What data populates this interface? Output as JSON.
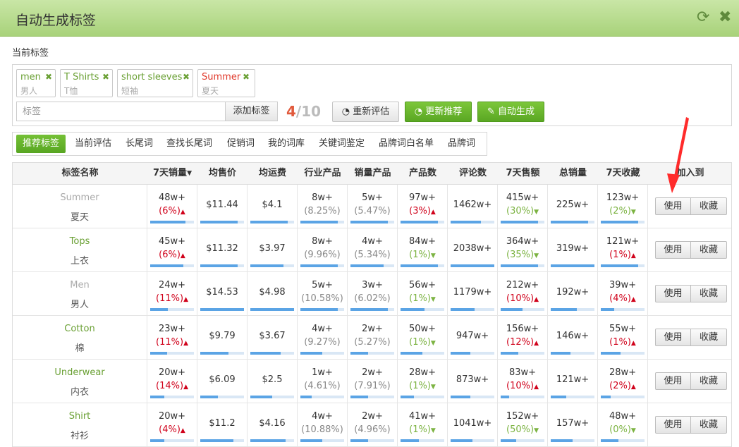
{
  "window": {
    "title": "自动生成标签"
  },
  "current_tags": {
    "label": "当前标签",
    "tags": [
      {
        "en": "men",
        "cn": "男人",
        "color": "green"
      },
      {
        "en": "T Shirts",
        "cn": "T恤",
        "color": "green"
      },
      {
        "en": "short sleeves",
        "cn": "短袖",
        "color": "green"
      },
      {
        "en": "Summer",
        "cn": "夏天",
        "color": "red"
      }
    ],
    "input_placeholder": "标签",
    "add_label": "添加标签",
    "count_current": "4",
    "count_separator": "/",
    "count_max": "10",
    "reevaluate_label": "重新评估",
    "update_recommend_label": "更新推荐",
    "auto_generate_label": "自动生成"
  },
  "tabs": [
    "推荐标签",
    "当前评估",
    "长尾词",
    "查找长尾词",
    "促销词",
    "我的词库",
    "关键词鉴定",
    "品牌词白名单",
    "品牌词"
  ],
  "table": {
    "headers": [
      "标签名称",
      "7天销量",
      "均售价",
      "均运费",
      "行业产品",
      "销量产品",
      "产品数",
      "评论数",
      "7天售额",
      "总销量",
      "7天收藏",
      "加入到"
    ],
    "use_label": "使用",
    "collect_label": "收藏",
    "rows": [
      {
        "en": "Summer",
        "cn": "夏天",
        "en_grey": true,
        "sales7": "48w+",
        "sales7_pct": "(6%)",
        "sales7_dir": "up",
        "price": "$11.44",
        "ship": "$4.1",
        "industry": "8w+",
        "industry_pct": "(8.25%)",
        "salesprod": "5w+",
        "salesprod_pct": "(5.47%)",
        "prodcount": "97w+",
        "prodcount_pct": "(3%)",
        "prodcount_dir": "up",
        "reviews": "1462w+",
        "rev7": "415w+",
        "rev7_pct": "(30%)",
        "rev7_dir": "down",
        "total": "225w+",
        "fav7": "123w+",
        "fav7_pct": "(2%)",
        "fav7_dir": "down"
      },
      {
        "en": "Tops",
        "cn": "上衣",
        "en_grey": false,
        "sales7": "45w+",
        "sales7_pct": "(6%)",
        "sales7_dir": "up",
        "price": "$11.32",
        "ship": "$3.97",
        "industry": "8w+",
        "industry_pct": "(9.96%)",
        "salesprod": "4w+",
        "salesprod_pct": "(5.34%)",
        "prodcount": "84w+",
        "prodcount_pct": "(1%)",
        "prodcount_dir": "down",
        "reviews": "2038w+",
        "rev7": "364w+",
        "rev7_pct": "(35%)",
        "rev7_dir": "down",
        "total": "319w+",
        "fav7": "121w+",
        "fav7_pct": "(1%)",
        "fav7_dir": "up"
      },
      {
        "en": "Men",
        "cn": "男人",
        "en_grey": true,
        "sales7": "24w+",
        "sales7_pct": "(11%)",
        "sales7_dir": "up",
        "price": "$14.53",
        "ship": "$4.98",
        "industry": "5w+",
        "industry_pct": "(10.58%)",
        "salesprod": "3w+",
        "salesprod_pct": "(6.02%)",
        "prodcount": "56w+",
        "prodcount_pct": "(1%)",
        "prodcount_dir": "down",
        "reviews": "1179w+",
        "rev7": "212w+",
        "rev7_pct": "(10%)",
        "rev7_dir": "up",
        "total": "192w+",
        "fav7": "39w+",
        "fav7_pct": "(4%)",
        "fav7_dir": "up"
      },
      {
        "en": "Cotton",
        "cn": "棉",
        "en_grey": false,
        "sales7": "23w+",
        "sales7_pct": "(11%)",
        "sales7_dir": "up",
        "price": "$9.79",
        "ship": "$3.67",
        "industry": "4w+",
        "industry_pct": "(9.27%)",
        "salesprod": "2w+",
        "salesprod_pct": "(5.27%)",
        "prodcount": "50w+",
        "prodcount_pct": "(1%)",
        "prodcount_dir": "down",
        "reviews": "947w+",
        "rev7": "156w+",
        "rev7_pct": "(12%)",
        "rev7_dir": "up",
        "total": "146w+",
        "fav7": "55w+",
        "fav7_pct": "(1%)",
        "fav7_dir": "up"
      },
      {
        "en": "Underwear",
        "cn": "内衣",
        "en_grey": false,
        "sales7": "20w+",
        "sales7_pct": "(14%)",
        "sales7_dir": "up",
        "price": "$6.09",
        "ship": "$2.5",
        "industry": "1w+",
        "industry_pct": "(4.61%)",
        "salesprod": "2w+",
        "salesprod_pct": "(7.91%)",
        "prodcount": "28w+",
        "prodcount_pct": "(1%)",
        "prodcount_dir": "down",
        "reviews": "873w+",
        "rev7": "83w+",
        "rev7_pct": "(10%)",
        "rev7_dir": "up",
        "total": "121w+",
        "fav7": "28w+",
        "fav7_pct": "(2%)",
        "fav7_dir": "up"
      },
      {
        "en": "Shirt",
        "cn": "衬衫",
        "en_grey": false,
        "sales7": "20w+",
        "sales7_pct": "(4%)",
        "sales7_dir": "up",
        "price": "$11.2",
        "ship": "$4.16",
        "industry": "4w+",
        "industry_pct": "(10.88%)",
        "salesprod": "2w+",
        "salesprod_pct": "(4.96%)",
        "prodcount": "41w+",
        "prodcount_pct": "(1%)",
        "prodcount_dir": "down",
        "reviews": "1041w+",
        "rev7": "152w+",
        "rev7_pct": "(50%)",
        "rev7_dir": "down",
        "total": "157w+",
        "fav7": "48w+",
        "fav7_pct": "(0%)",
        "fav7_dir": "down"
      }
    ]
  },
  "colors": {
    "accent_green": "#6aa034",
    "up_red": "#d0021b",
    "down_green": "#7cb342",
    "bar_blue": "#5ba4e5",
    "count_red": "#e15a3c"
  },
  "icons": {
    "refresh": "refresh-icon",
    "close": "close-icon",
    "reevaluate": "dashboard-icon",
    "update": "dashboard-icon",
    "auto": "pencil-icon"
  }
}
